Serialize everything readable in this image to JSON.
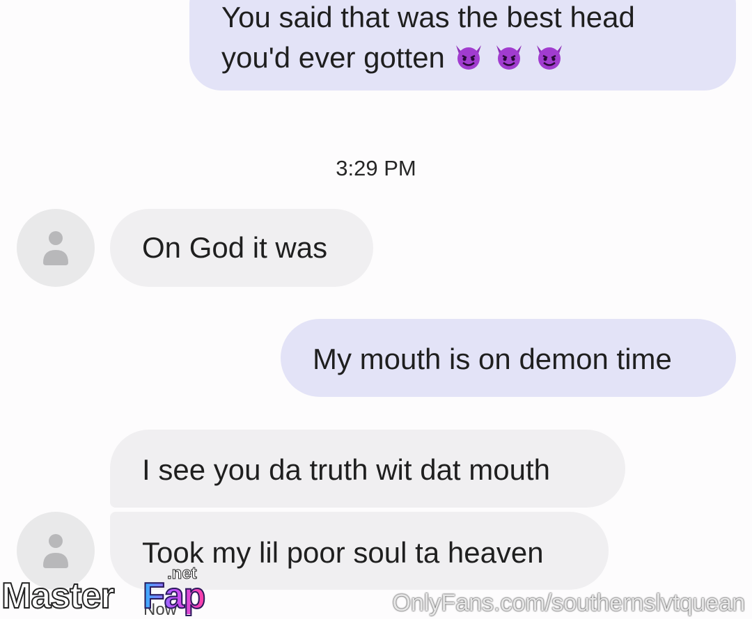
{
  "messages": [
    {
      "text": "You said that was the best head you'd ever gotten",
      "emoji": [
        "smiling-devil-icon",
        "smiling-devil-icon",
        "smiling-devil-icon"
      ]
    },
    {
      "text": "On God it was"
    },
    {
      "text": "My mouth is on demon time"
    },
    {
      "text": "I see you da truth wit dat mouth"
    },
    {
      "text": "Took my lil poor soul ta heaven"
    }
  ],
  "timestamp": "3:29 PM",
  "status": "Now",
  "watermark": {
    "logo_part1": "Master",
    "logo_part2": "Fap",
    "logo_part3": ".net",
    "url": "OnlyFans.com/southernslvtquean"
  },
  "colors": {
    "outgoing_bubble": "#e3e3f7",
    "incoming_bubble": "#f0eff1",
    "devil_emoji": "#a13ccf"
  }
}
